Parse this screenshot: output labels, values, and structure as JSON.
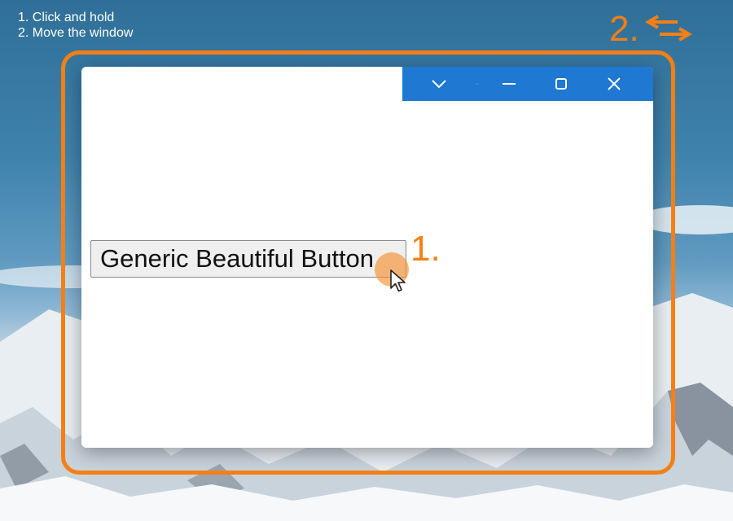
{
  "instructions": {
    "line1": "1. Click and hold",
    "line2": "2. Move the window"
  },
  "steps": {
    "step1": "1.",
    "step2": "2."
  },
  "window": {
    "button_label": "Generic Beautiful Button",
    "title_bar_color": "#1f78d1",
    "controls": [
      "chevron-down-icon",
      "more-dots-icon",
      "minimize-icon",
      "maximize-icon",
      "close-icon"
    ]
  },
  "colors": {
    "accent": "#f57f14",
    "title_bar": "#1f78d1"
  },
  "icons": {
    "move": "move-arrows-icon",
    "cursor": "cursor-icon"
  }
}
